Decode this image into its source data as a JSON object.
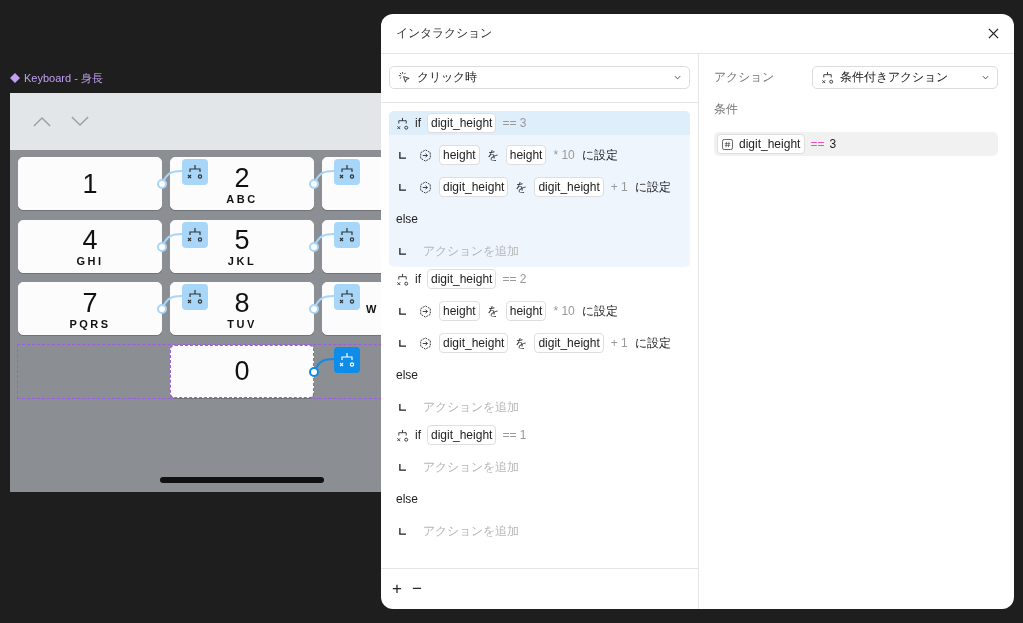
{
  "canvas": {
    "frame_label": "Keyboard - 身長",
    "key_rows": [
      {
        "keys": [
          {
            "digit": "1",
            "interaction": true,
            "selected": false
          },
          {
            "digit": "2",
            "letters": "ABC",
            "interaction": true,
            "selected": false
          },
          {
            "selected": false
          }
        ]
      },
      {
        "keys": [
          {
            "digit": "4",
            "letters": "GHI",
            "interaction": true,
            "selected": false
          },
          {
            "digit": "5",
            "letters": "JKL",
            "interaction": true,
            "selected": false
          },
          {
            "selected": false
          }
        ]
      },
      {
        "keys": [
          {
            "digit": "7",
            "letters": "PQRS",
            "interaction": true,
            "selected": false
          },
          {
            "digit": "8",
            "letters": "TUV",
            "interaction": true,
            "selected": false
          },
          {
            "letters": "W",
            "selected": false
          }
        ]
      },
      {
        "keys": [
          {
            "kind": "empty"
          },
          {
            "digit": "0",
            "interaction": true,
            "selected": true
          }
        ]
      }
    ]
  },
  "dialog": {
    "title": "インタラクション",
    "trigger": {
      "value": "クリック時"
    },
    "blocks": [
      {
        "selected": true,
        "keyword": "if",
        "variable": "digit_height",
        "comparison": "== 3",
        "actions": [
          {
            "kind": "set",
            "target": "height",
            "particle": "を",
            "source": "height",
            "expr": "* 10",
            "suffix": "に設定"
          },
          {
            "kind": "set",
            "target": "digit_height",
            "particle": "を",
            "source": "digit_height",
            "expr": "+ 1",
            "suffix": "に設定"
          }
        ],
        "else_label": "else",
        "else_actions": [
          {
            "kind": "add",
            "label": "アクションを追加"
          }
        ]
      },
      {
        "selected": false,
        "keyword": "if",
        "variable": "digit_height",
        "comparison": "== 2",
        "actions": [
          {
            "kind": "set",
            "target": "height",
            "particle": "を",
            "source": "height",
            "expr": "* 10",
            "suffix": "に設定"
          },
          {
            "kind": "set",
            "target": "digit_height",
            "particle": "を",
            "source": "digit_height",
            "expr": "+ 1",
            "suffix": "に設定"
          }
        ],
        "else_label": "else",
        "else_actions": [
          {
            "kind": "add",
            "label": "アクションを追加"
          }
        ]
      },
      {
        "selected": false,
        "keyword": "if",
        "variable": "digit_height",
        "comparison": "== 1",
        "actions": [
          {
            "kind": "add",
            "label": "アクションを追加"
          }
        ],
        "else_label": "else",
        "else_actions": [
          {
            "kind": "add",
            "label": "アクションを追加"
          }
        ]
      }
    ],
    "footer": {
      "add": "+",
      "remove": "−"
    },
    "action_label": "アクション",
    "action_value": "条件付きアクション",
    "condition_label": "条件",
    "condition": {
      "variable": "digit_height",
      "operator": "==",
      "value": "3"
    }
  }
}
